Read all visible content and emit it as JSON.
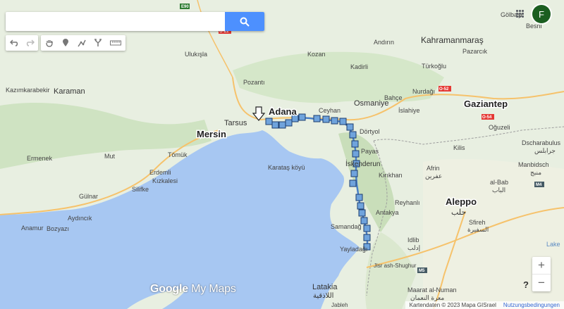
{
  "search": {
    "placeholder": "",
    "value": ""
  },
  "account": {
    "avatar_letter": "F"
  },
  "watermark": {
    "google": "Google",
    "product": "My Maps"
  },
  "footer": {
    "attribution": "Kartendaten © 2023 Mapa GISrael",
    "terms": "Nutzungsbedingungen"
  },
  "zoom": {
    "in": "+",
    "out": "−"
  },
  "help": {
    "label": "?"
  },
  "colors": {
    "sea": "#a7c7f2",
    "land": "#e8efe1",
    "forest": "#cfe3c2",
    "route": "#4a80c8",
    "marker": "#6fa3dc"
  },
  "places": {
    "adana": "Adana",
    "mersin": "Mersin",
    "tarsus": "Tarsus",
    "iskenderun": "İskenderun",
    "osmaniye": "Osmaniye",
    "gaziantep": "Gaziantep",
    "kahramanmaras": "Kahramanmaraş",
    "aleppo": "Aleppo",
    "aleppo_ar": "حلب",
    "karaman": "Karaman",
    "latakia": "Latakia",
    "latakia_ar": "اللاذقية",
    "ceyhan": "Ceyhan",
    "dortyol": "Dörtyol",
    "payas": "Payas",
    "kozan": "Kozan",
    "kadirli": "Kadirli",
    "bahce": "Bahçe",
    "islahiye": "İslahiye",
    "nurdagi": "Nurdağı",
    "turkoglu": "Türkoğlu",
    "pazarcik": "Pazarcık",
    "oguzeli": "Oğuzeli",
    "kilis": "Kilis",
    "afrin": "Afrin",
    "afrin_ar": "عفرين",
    "mut": "Mut",
    "gulnar": "Gülnar",
    "silifke": "Silifke",
    "anamur": "Anamur",
    "bozyazi": "Bozyazı",
    "aydincik": "Aydıncık",
    "erdemli": "Erdemli",
    "kizkalesi": "Kızkalesi",
    "tomuk": "Tömük",
    "karatas": "Karataş köyü",
    "samandag": "Samandağ",
    "yayladagi": "Yayladağı",
    "idlib": "Idlib",
    "idlib_ar": "إدلب",
    "ulukisla": "Ulukışla",
    "pozanti": "Pozantı",
    "kazimkarabekir": "Kazımkarabekir",
    "ermenek": "Ermenek",
    "andirin": "Andırın",
    "kirikhan": "Kırıkhan",
    "reyhanli": "Reyhanlı",
    "antakya": "Antakya",
    "jisr": "Jisr ash-Shughur",
    "jableh": "Jableh",
    "besni": "Besni",
    "gobeli": "Gölbaşı",
    "safira": "Sfireh",
    "safira_ar": "السفيرة",
    "albab": "al-Bab",
    "albab_ar": "الباب",
    "maarat": "Maarat al-Numan",
    "maarat_ar": "معرة النعمان",
    "mambidsch": "Manbidsch",
    "mambidsch_ar": "منبج",
    "dscharabulus": "Dscharabulus",
    "dscharabulus_ar": "جرابلس",
    "lake": "Lake",
    "road_e90": "E90",
    "road_o21": "O-21",
    "road_o52": "O-52",
    "road_o54": "O-54",
    "road_m4": "M4",
    "road_m5": "M5"
  }
}
